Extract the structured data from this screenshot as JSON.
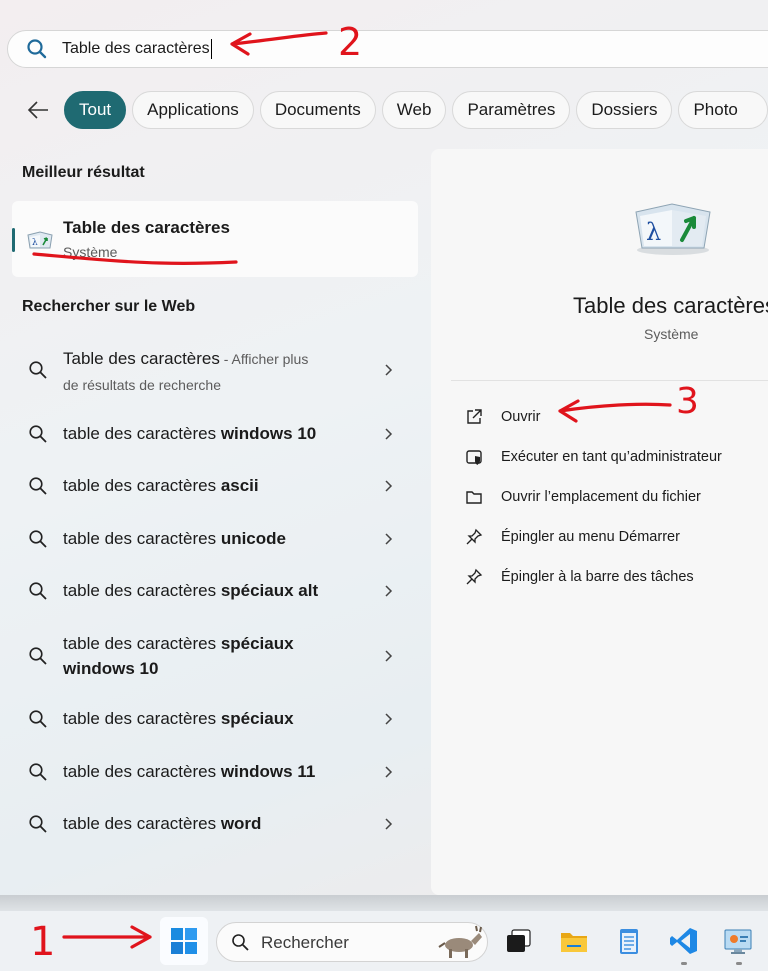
{
  "search": {
    "query": "Table des caractères"
  },
  "filters": [
    "Tout",
    "Applications",
    "Documents",
    "Web",
    "Paramètres",
    "Dossiers",
    "Photo"
  ],
  "best_match": {
    "heading": "Meilleur résultat",
    "name": "Table des caractères",
    "type": "Système"
  },
  "web": {
    "heading": "Rechercher sur le Web",
    "items": [
      {
        "base": "Table des caractères",
        "bold": "",
        "suffix": " - Afficher plus",
        "line2": "de résultats de recherche"
      },
      {
        "base": "table des caractères ",
        "bold": "windows 10"
      },
      {
        "base": "table des caractères ",
        "bold": "ascii"
      },
      {
        "base": "table des caractères ",
        "bold": "unicode"
      },
      {
        "base": "table des caractères ",
        "bold": "spéciaux alt"
      },
      {
        "base": "table des caractères ",
        "bold": "spéciaux",
        "line2": "windows 10"
      },
      {
        "base": "table des caractères ",
        "bold": "spéciaux"
      },
      {
        "base": "table des caractères ",
        "bold": "windows 11"
      },
      {
        "base": "table des caractères ",
        "bold": "word"
      }
    ]
  },
  "preview": {
    "title": "Table des caractères",
    "type": "Système",
    "actions": [
      {
        "label": "Ouvrir",
        "icon": "open-external-icon"
      },
      {
        "label": "Exécuter en tant qu’administrateur",
        "icon": "shield-admin-icon"
      },
      {
        "label": "Ouvrir l’emplacement du fichier",
        "icon": "folder-icon"
      },
      {
        "label": "Épingler au menu Démarrer",
        "icon": "pin-icon"
      },
      {
        "label": "Épingler à la barre des tâches",
        "icon": "pin-icon"
      }
    ]
  },
  "taskbar": {
    "search_placeholder": "Rechercher",
    "apps": [
      "task-view-icon",
      "file-explorer-icon",
      "notepad-icon",
      "vscode-icon",
      "control-panel-icon"
    ]
  },
  "annotations": [
    "1",
    "2",
    "3"
  ],
  "colors": {
    "accent": "#1f6a72",
    "annotation": "#e0141c"
  }
}
